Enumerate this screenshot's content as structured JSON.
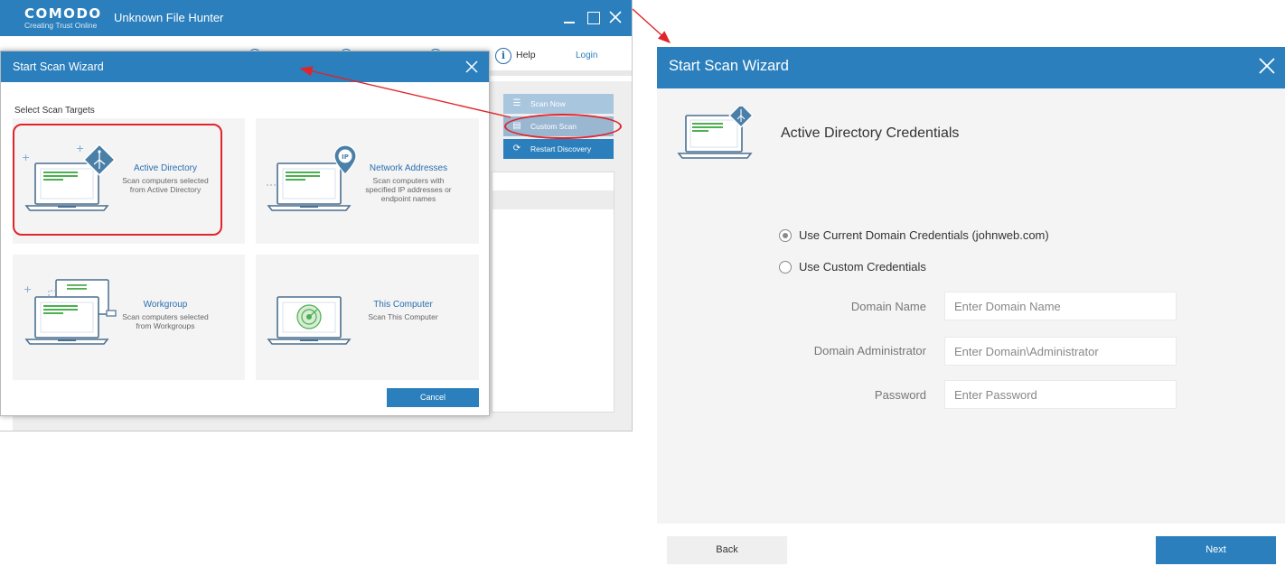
{
  "app": {
    "brand_name": "COMODO",
    "brand_tagline": "Creating Trust Online",
    "title": "Unknown File Hunter",
    "help_label": "Help",
    "login_label": "Login",
    "side_buttons": {
      "scan_now": "Scan Now",
      "custom_scan": "Custom Scan",
      "restart_discovery": "Restart Discovery"
    }
  },
  "small_wizard": {
    "title": "Start Scan Wizard",
    "subtitle": "Select Scan Targets",
    "cards": [
      {
        "title": "Active Directory",
        "desc": "Scan computers selected from Active Directory"
      },
      {
        "title": "Network Addresses",
        "desc": "Scan computers with specified IP addresses or endpoint names"
      },
      {
        "title": "Workgroup",
        "desc": "Scan computers selected from Workgroups"
      },
      {
        "title": "This Computer",
        "desc": "Scan This Computer"
      }
    ],
    "ip_badge": "IP",
    "cancel_label": "Cancel"
  },
  "large_wizard": {
    "title": "Start Scan Wizard",
    "heading": "Active Directory Credentials",
    "radio_current": "Use Current Domain Credentials (johnweb.com)",
    "radio_custom": "Use Custom Credentials",
    "selected_option": "current",
    "fields": {
      "domain_name": {
        "label": "Domain Name",
        "placeholder": "Enter Domain Name"
      },
      "domain_admin": {
        "label": "Domain Administrator",
        "placeholder": "Enter Domain\\Administrator"
      },
      "password": {
        "label": "Password",
        "placeholder": "Enter Password"
      }
    },
    "back_label": "Back",
    "next_label": "Next"
  },
  "colors": {
    "accent": "#2a7fbc",
    "highlight": "#e0242b",
    "screen_green": "#4caf50"
  }
}
